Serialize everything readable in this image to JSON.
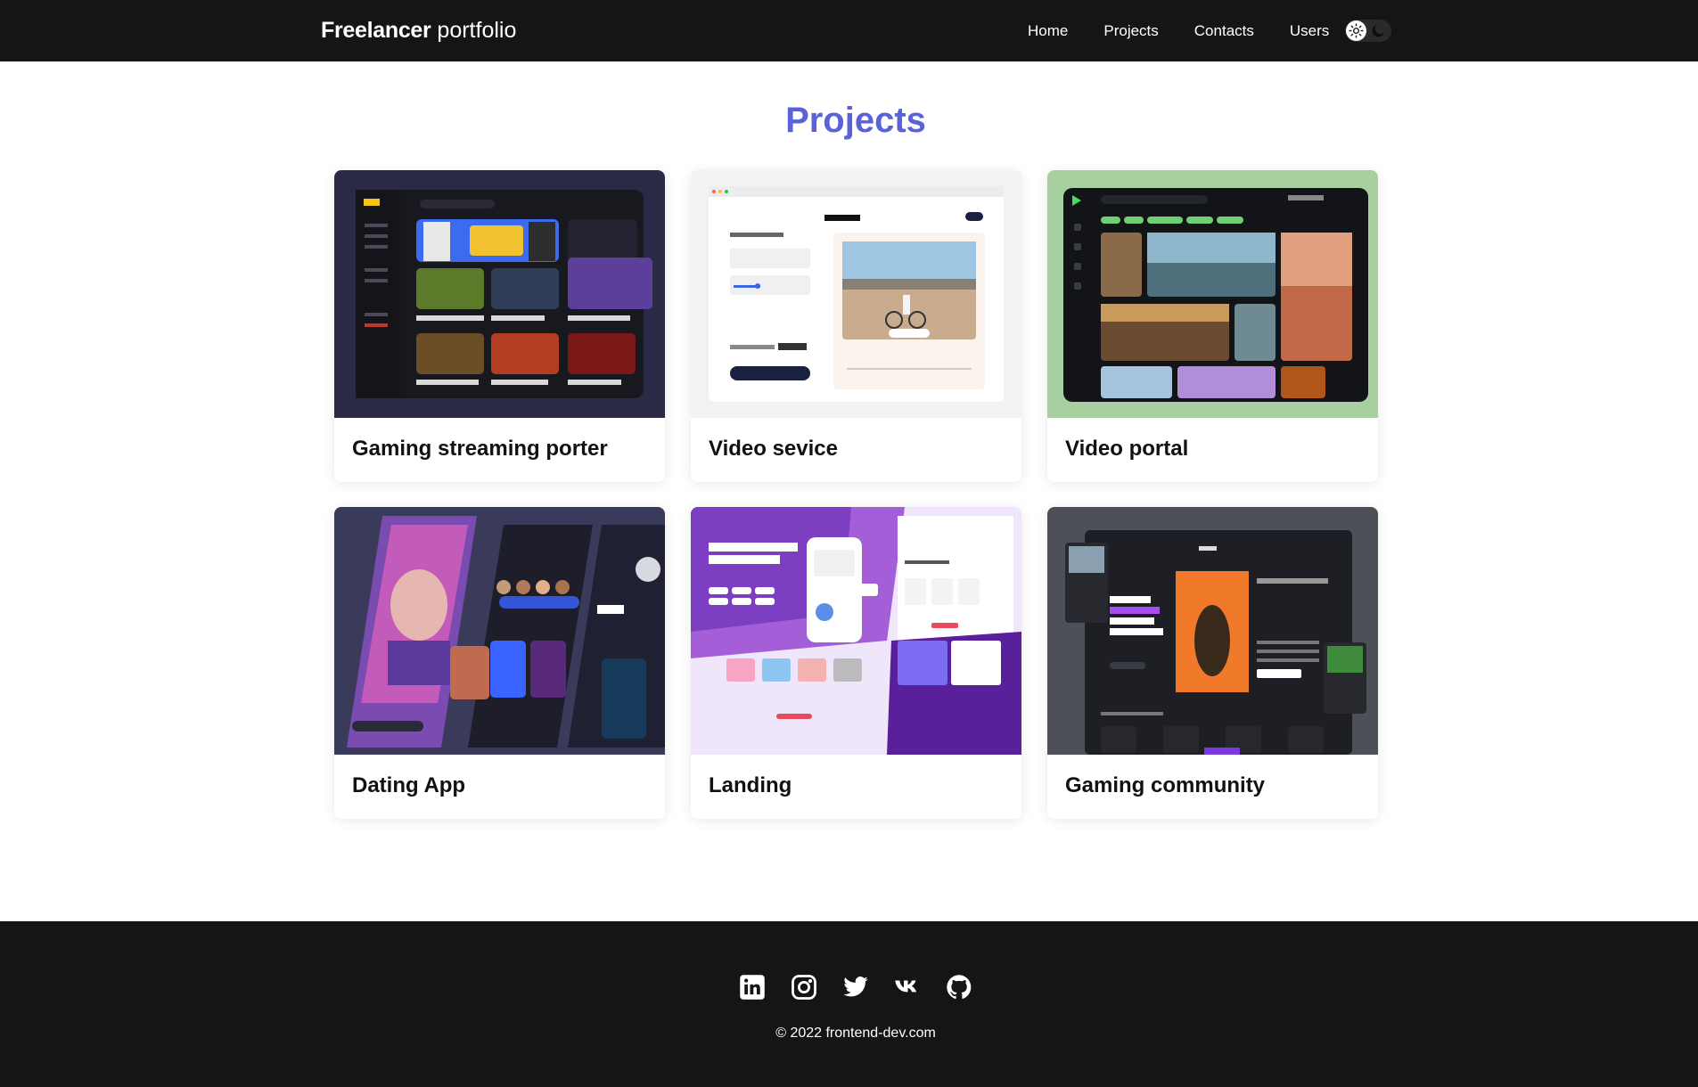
{
  "header": {
    "brand_bold": "Freelancer",
    "brand_rest": " portfolio",
    "nav": [
      "Home",
      "Projects",
      "Contacts",
      "Users"
    ],
    "theme_icons": [
      "sun-icon",
      "moon-icon"
    ]
  },
  "main": {
    "title": "Projects",
    "title_color": "#5b61d9",
    "projects": [
      {
        "title": "Gaming streaming porter",
        "thumb_bg": "#2b2a46"
      },
      {
        "title": "Video sevice",
        "thumb_bg": "#f2f2f4"
      },
      {
        "title": "Video portal",
        "thumb_bg": "#a8cfa0"
      },
      {
        "title": "Dating App",
        "thumb_bg": "#3a3a5a"
      },
      {
        "title": "Landing",
        "thumb_bg": "#d8c3f3"
      },
      {
        "title": "Gaming community",
        "thumb_bg": "#4d5058"
      }
    ]
  },
  "footer": {
    "socials": [
      "linkedin-icon",
      "instagram-icon",
      "twitter-icon",
      "vk-icon",
      "github-icon"
    ],
    "copyright": "© 2022 frontend-dev.com"
  }
}
